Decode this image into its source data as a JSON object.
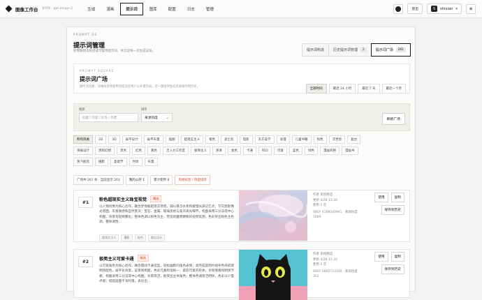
{
  "topbar": {
    "title": "图像工作台",
    "subtitle": "BYOK · gpt-image-2",
    "nav": [
      "生成",
      "漫画",
      "提示词",
      "图库",
      "配置",
      "日志",
      "管理"
    ],
    "active_index": 2,
    "login_label": "登出",
    "user_initial": "S",
    "user_name": "shixian"
  },
  "header": {
    "kicker": "PROMPT OS",
    "title": "提示词管理",
    "desc": "把零散想法组合成可复用提示词，并沉淀每一次生成记录。",
    "tabs": [
      {
        "label": "提示词构造",
        "count": ""
      },
      {
        "label": "历史提示词管理",
        "count": "2"
      },
      {
        "label": "提示词广场",
        "count": "261"
      }
    ]
  },
  "square": {
    "kicker": "PROMPT SQUARE",
    "title": "提示词广场",
    "desc": "随时浏览图、风格标签和使用热度浏览用户公开提示词，可一键送到生成页或保存到历史。",
    "time_filters": [
      "全部时间",
      "最近 24 小时",
      "最近 7 天",
      "最近一个月"
    ]
  },
  "search": {
    "search_label": "搜索",
    "search_placeholder": "标题 / 内容 / 标签 / 作者",
    "sort_label": "排序",
    "sort_value": "来源热度",
    "refresh_label": "刷新广场"
  },
  "tags": [
    "所有风格",
    "2D",
    "3D",
    "扁平设计",
    "扁平矢量",
    "插图",
    "超现实主义",
    "橙色",
    "迪士尼",
    "电影",
    "东方美学",
    "动漫",
    "儿童书籍",
    "粉色",
    "浮世绘",
    "复古",
    "海报设计",
    "黑暗幻想",
    "黑色",
    "红色",
    "黄色",
    "吉卜力工作室",
    "极简主义",
    "蒸蒸",
    "金色",
    "卡通",
    "科幻",
    "可爱",
    "蓝色",
    "绿色",
    "漫画风格",
    "漫画书",
    "蒸汽朋克",
    "摄影",
    "圣诞节",
    "时尚",
    "矢量"
  ],
  "filters": {
    "chips": [
      "广场共 261 条 · 当前显示 261",
      "我的公开 1",
      "累计使用 8",
      "风格标签 / 热度排序"
    ]
  },
  "cards": [
    {
      "rank": "#1",
      "title": "粉色超现实主义珠宝视觉",
      "badge": "精选",
      "text": "以人物肖像为核心创作，融合梦境般超现实场景，辅以悬浮水系和缓慢光泽记忆点；写实感影像光谱面，丰富质感和自然景深；宝石、金属、玻璃反射与柔华高光细节，构图采用三分法或中心构图，背景有轻微雾化；整体色调以粉色为主，营造优雅而精致的视觉氛围；色彩突出粉色主色调，整体调性...",
      "tags": [
        "超现实主义",
        "摄影",
        "粉色",
        "珠宝设计"
      ],
      "author": "作者 系统精选",
      "date": "更新 4/28 15:30",
      "uses": "使用 2 次",
      "src": "SREF 4169240941 · 来源热度 1089",
      "use_label": "使用",
      "copy_label": "复制",
      "save_label": "保存到历史"
    },
    {
      "rank": "#2",
      "title": "极简主义可爱卡通",
      "badge": "精选",
      "text": "以可爱角色为核心创作，融合圆润卡通造型，轻松幽默的角色表情；高完成度简约线条色块搭建明快配色，扁平化背景，前景和构图，色彩元素和谐统一；柔软可爱的形体，亲和情绪和明快节奏；构图采用三分法或中心构图；背景简洁，能突出主体角色；整体色调简洁明快，色彩以少量点缀；搭配画面干净利落，表达出...",
      "tags": [],
      "author": "作者 系统精选",
      "date": "更新 4/28 15:30",
      "uses": "使用 0 次",
      "src": "SREF 6805723300 · 来源热度 301",
      "use_label": "使用",
      "copy_label": "复制",
      "save_label": "保存到历史"
    }
  ]
}
